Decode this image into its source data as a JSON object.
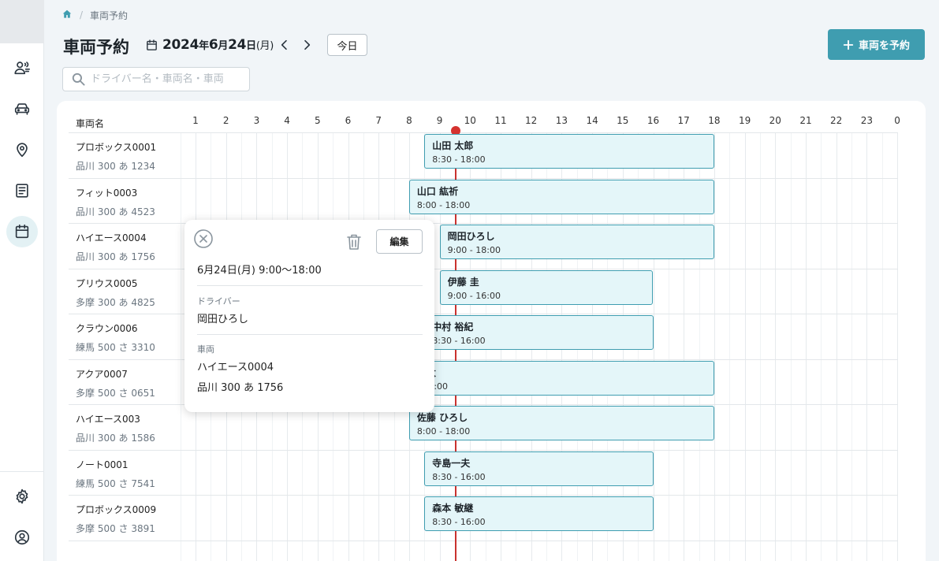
{
  "breadcrumb": {
    "current": "車両予約"
  },
  "page": {
    "title": "車両予約"
  },
  "date_nav": {
    "year": "2024",
    "year_suffix": "年",
    "month": "6",
    "month_suffix": "月",
    "day": "24",
    "day_suffix": "日",
    "weekday": "(月)",
    "today_label": "今日"
  },
  "book_button": {
    "label": "車両を予約"
  },
  "search": {
    "placeholder": "ドライバー名・車両名・車両",
    "value": ""
  },
  "timeline": {
    "vehicle_column_label": "車両名",
    "hours": [
      "1",
      "2",
      "3",
      "4",
      "5",
      "6",
      "7",
      "8",
      "9",
      "10",
      "11",
      "12",
      "13",
      "14",
      "15",
      "16",
      "17",
      "18",
      "19",
      "20",
      "21",
      "22",
      "23",
      "0"
    ],
    "vehicles": [
      {
        "name": "プロボックス0001",
        "plate": "品川 300 あ 1234"
      },
      {
        "name": "フィット0003",
        "plate": "品川 300 あ 4523"
      },
      {
        "name": "ハイエース0004",
        "plate": "品川 300 あ 1756"
      },
      {
        "name": "プリウス0005",
        "plate": "多摩 300 あ 4825"
      },
      {
        "name": "クラウン0006",
        "plate": "練馬 500 さ 3310"
      },
      {
        "name": "アクア0007",
        "plate": "多摩 500 さ 0651"
      },
      {
        "name": "ハイエース003",
        "plate": "品川 300 あ 1586"
      },
      {
        "name": "ノート0001",
        "plate": "練馬 500 さ 7541"
      },
      {
        "name": "プロボックス0009",
        "plate": "多摩 500 さ 3891"
      }
    ],
    "reservations": [
      {
        "row": 0,
        "driver": "山田 太郎",
        "time": "8:30 - 18:00"
      },
      {
        "row": 1,
        "driver": "山口 紘祈",
        "time": "8:00 - 18:00"
      },
      {
        "row": 2,
        "driver": "岡田ひろし",
        "time": "9:00 - 18:00"
      },
      {
        "row": 3,
        "driver": "伊藤 圭",
        "time": "9:00 - 16:00"
      },
      {
        "row": 4,
        "driver": "中村 裕紀",
        "time": "8:30 - 16:00"
      },
      {
        "row": 5,
        "driver": "涼太",
        "time": "- 18:00"
      },
      {
        "row": 6,
        "driver": "佐藤 ひろし",
        "time": "8:00 - 18:00"
      },
      {
        "row": 7,
        "driver": "寺島一夫",
        "time": "8:30 - 16:00"
      },
      {
        "row": 8,
        "driver": "森本 敏継",
        "time": "8:30 - 16:00"
      }
    ]
  },
  "popup": {
    "datetime": "6月24日(月) 9:00〜18:00",
    "driver_label": "ドライバー",
    "driver": "岡田ひろし",
    "vehicle_label": "車両",
    "vehicle": "ハイエース0004",
    "plate": "品川 300 あ 1756",
    "edit_label": "編集"
  },
  "colors": {
    "accent": "#3f9db0",
    "now_line": "#c9322f",
    "bar_fill": "#e4f6f9"
  }
}
